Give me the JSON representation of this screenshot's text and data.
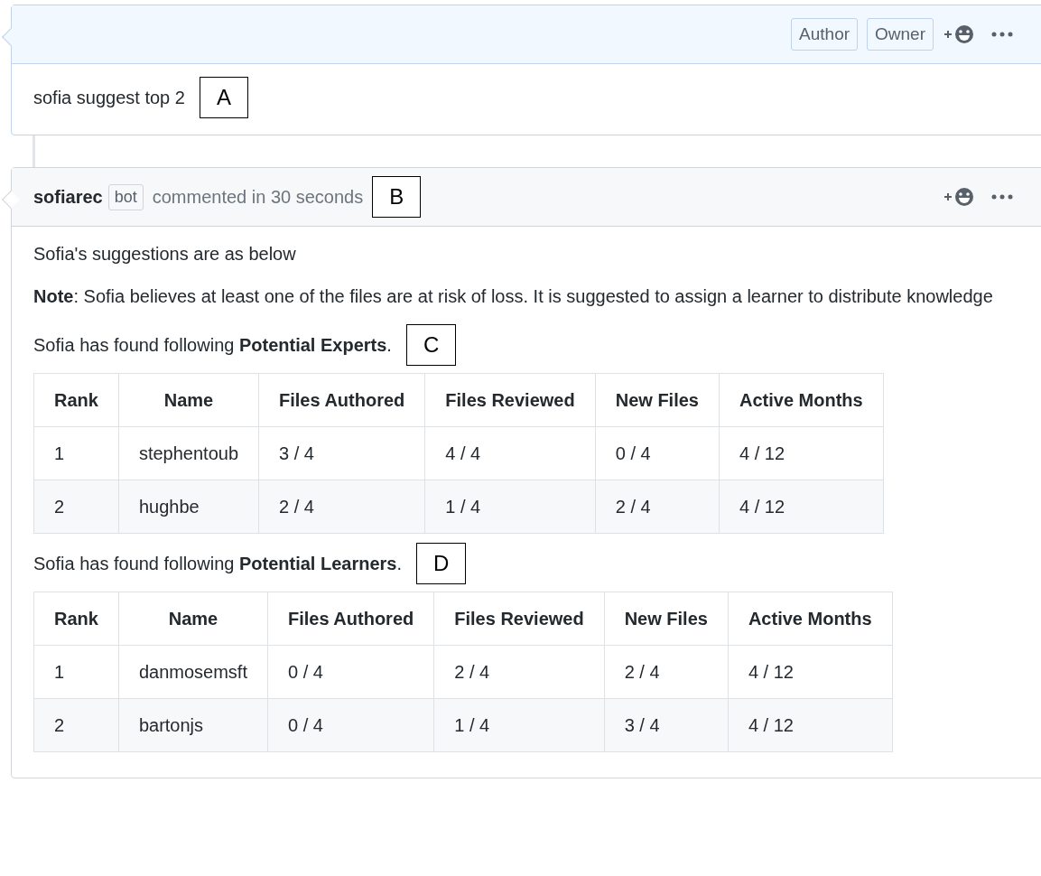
{
  "comments": [
    {
      "kind": "owner",
      "header": {
        "badges": [
          "Author",
          "Owner"
        ]
      },
      "paragraphs": [
        "sofia suggest top 2"
      ],
      "annotation": "A"
    },
    {
      "kind": "bot",
      "header": {
        "author": "sofiarec",
        "badges": [
          "bot"
        ],
        "action": "commented in 30 seconds",
        "annotation": "B"
      },
      "paragraphs": [
        "Sofia's suggestions are as below",
        "**Note**: Sofia believes at least one of the files are at risk of loss. It is suggested to assign a learner to distribute knowledge"
      ],
      "sections": [
        {
          "intro": "Sofia has found following **Potential Experts**.",
          "annotation": "C",
          "table": {
            "columns": [
              "Rank",
              "Name",
              "Files Authored",
              "Files Reviewed",
              "New Files",
              "Active Months"
            ],
            "rows": [
              [
                "1",
                "stephentoub",
                "3 / 4",
                "4 / 4",
                "0 / 4",
                "4 / 12"
              ],
              [
                "2",
                "hughbe",
                "2 / 4",
                "1 / 4",
                "2 / 4",
                "4 / 12"
              ]
            ]
          }
        },
        {
          "intro": "Sofia has found following **Potential Learners**.",
          "annotation": "D",
          "table": {
            "columns": [
              "Rank",
              "Name",
              "Files Authored",
              "Files Reviewed",
              "New Files",
              "Active Months"
            ],
            "rows": [
              [
                "1",
                "danmosemsft",
                "0 / 4",
                "2 / 4",
                "2 / 4",
                "4 / 12"
              ],
              [
                "2",
                "bartonjs",
                "0 / 4",
                "1 / 4",
                "3 / 4",
                "4 / 12"
              ]
            ]
          }
        }
      ]
    }
  ]
}
